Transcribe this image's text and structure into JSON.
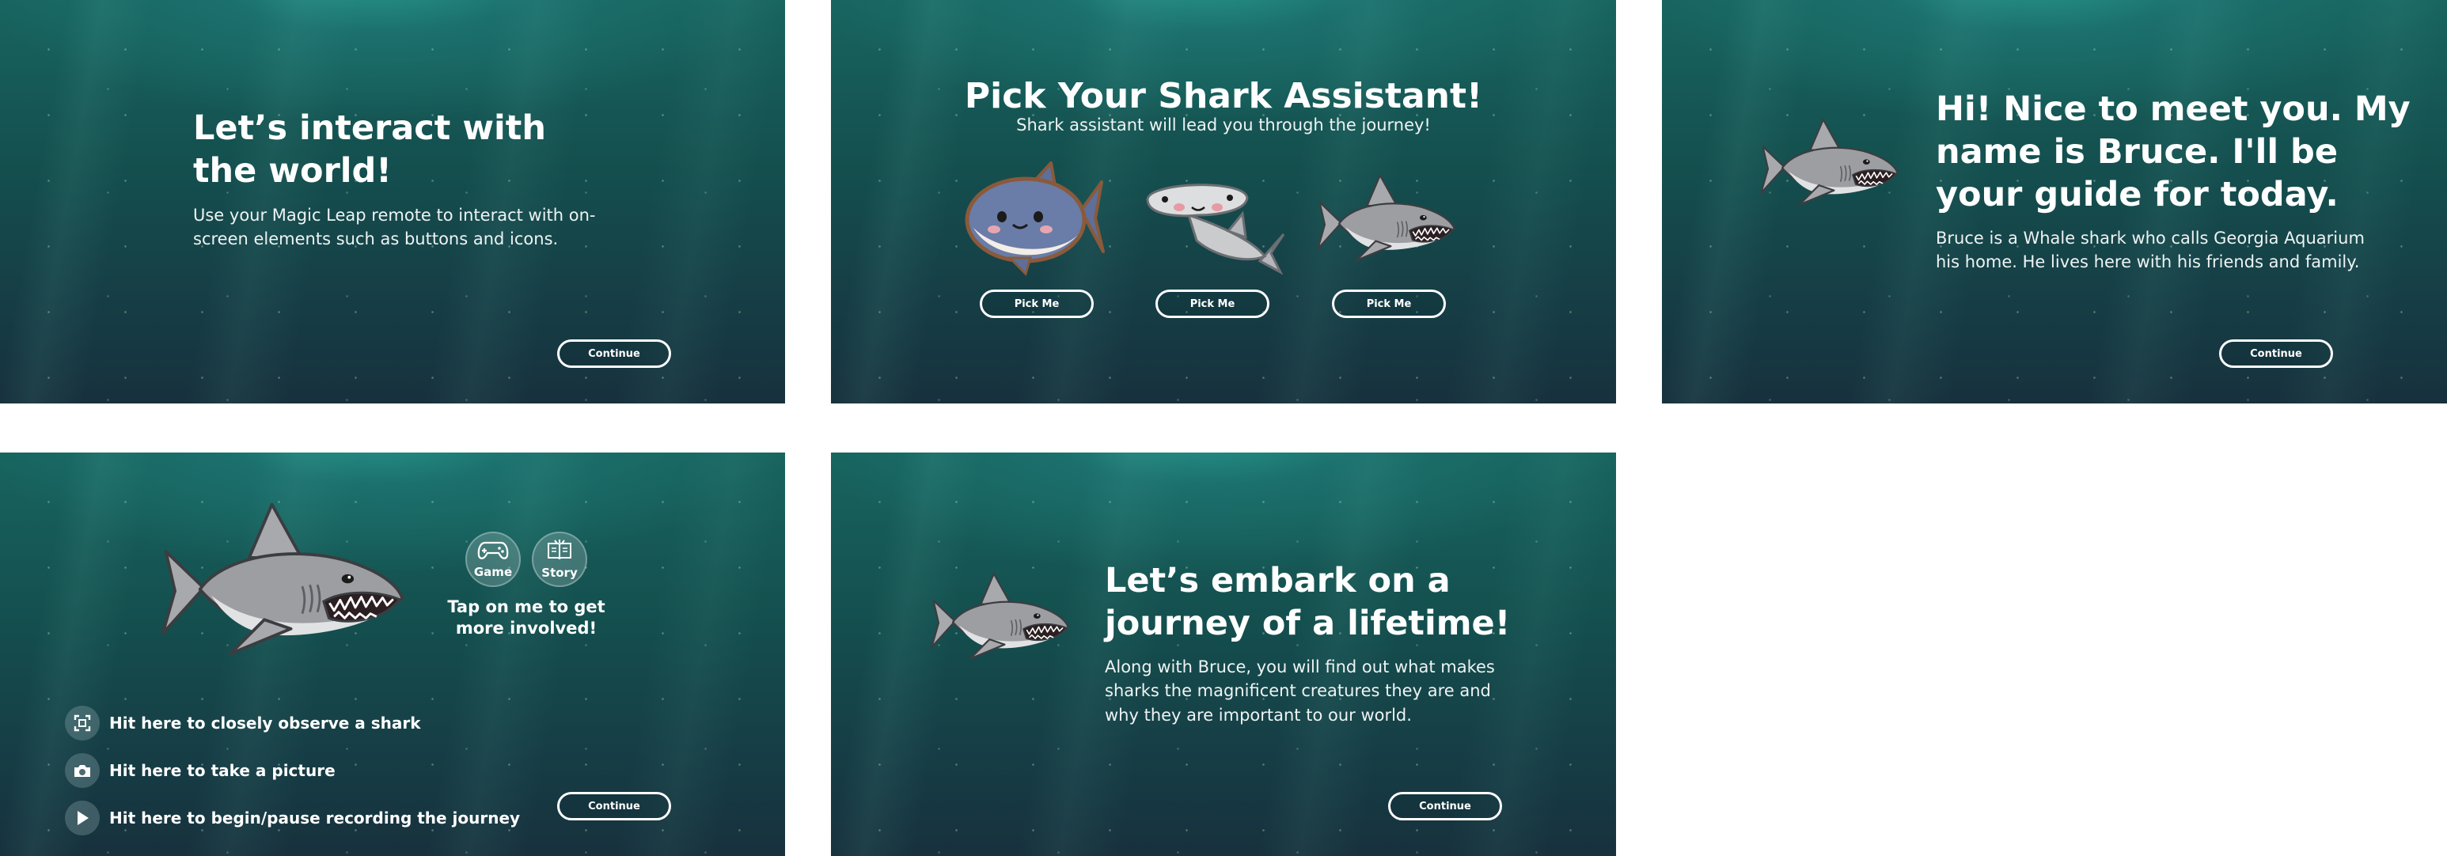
{
  "screens": {
    "interact": {
      "title": "Let’s interact with the world!",
      "body": "Use your Magic Leap remote to interact with on-screen elements such as buttons and icons.",
      "continue_label": "Continue"
    },
    "pick": {
      "title": "Pick Your Shark Assistant!",
      "subtitle": "Shark assistant will lead you through the journey!",
      "options": [
        {
          "label": "Pick Me",
          "icon": "cute-whale-shark-icon"
        },
        {
          "label": "Pick Me",
          "icon": "hammerhead-shark-icon"
        },
        {
          "label": "Pick Me",
          "icon": "great-white-shark-icon"
        }
      ]
    },
    "intro": {
      "title": "Hi! Nice to meet you. My name is Bruce.  I'll be your guide for today.",
      "body": "Bruce is a Whale shark who calls Georgia Aquarium his home. He lives here with his friends and family.",
      "continue_label": "Continue"
    },
    "controls": {
      "modes": [
        {
          "label": "Game",
          "icon": "gamepad-icon"
        },
        {
          "label": "Story",
          "icon": "book-icon"
        }
      ],
      "tap_text": "Tap on me to get more involved!",
      "hints": [
        {
          "label": "Hit here to closely observe a shark",
          "icon": "focus-frame-icon"
        },
        {
          "label": "Hit here to take a picture",
          "icon": "camera-icon"
        },
        {
          "label": "Hit here to begin/pause recording the journey",
          "icon": "play-icon"
        }
      ],
      "continue_label": "Continue"
    },
    "embark": {
      "title": "Let’s embark on a journey of a lifetime!",
      "body": "Along with Bruce, you will find out what makes sharks the magnificent creatures they are and why they are important to our world.",
      "continue_label": "Continue"
    }
  },
  "colors": {
    "ocean_top": "#2a9c92",
    "ocean_bottom": "#17313d",
    "text": "#ffffff",
    "shark_body": "#9c9ea1",
    "shark_outline": "#3b3d40"
  }
}
